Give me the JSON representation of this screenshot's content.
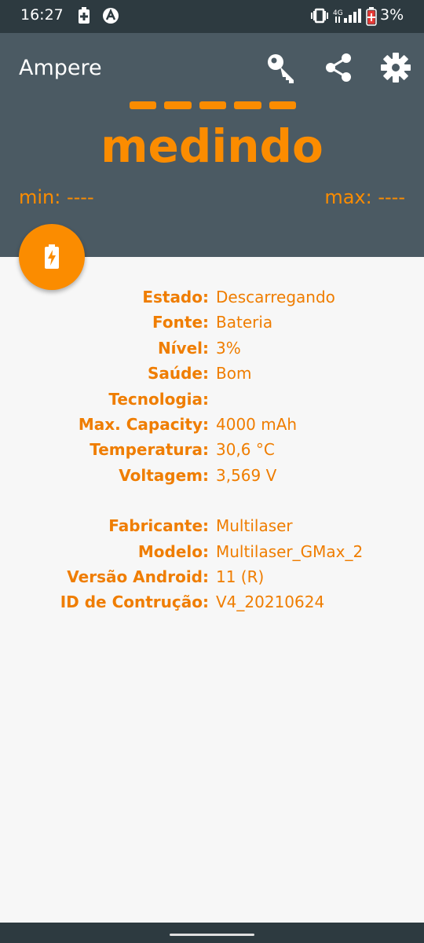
{
  "status_bar": {
    "time": "16:27",
    "battery_percent": "3%",
    "icons": [
      "battery-saver-icon",
      "a-circle-icon",
      "vibrate-icon",
      "signal-icon",
      "battery-low-icon"
    ]
  },
  "app_bar": {
    "title": "Ampere",
    "actions": [
      "key-icon",
      "share-icon",
      "settings-icon"
    ]
  },
  "reading": {
    "dashes": "-----",
    "status": "medindo",
    "min_label": "min: ----",
    "max_label": "max: ----"
  },
  "fab": {
    "icon": "battery-charging-icon"
  },
  "battery_info": [
    {
      "label": "Estado:",
      "value": "Descarregando"
    },
    {
      "label": "Fonte:",
      "value": "Bateria"
    },
    {
      "label": "Nível:",
      "value": "3%"
    },
    {
      "label": "Saúde:",
      "value": "Bom"
    },
    {
      "label": "Tecnologia:",
      "value": ""
    },
    {
      "label": "Max. Capacity:",
      "value": "4000 mAh"
    },
    {
      "label": "Temperatura:",
      "value": "30,6 °C"
    },
    {
      "label": "Voltagem:",
      "value": "3,569 V"
    }
  ],
  "device_info": [
    {
      "label": "Fabricante:",
      "value": "Multilaser"
    },
    {
      "label": "Modelo:",
      "value": "Multilaser_GMax_2"
    },
    {
      "label": "Versão Android:",
      "value": "11 (R)"
    },
    {
      "label": "ID de Contrução:",
      "value": "V4_20210624"
    }
  ],
  "colors": {
    "accent": "#fb8c00",
    "app_bar": "#4b5a63",
    "status_bar": "#2d3a40",
    "background": "#f7f7f7"
  }
}
